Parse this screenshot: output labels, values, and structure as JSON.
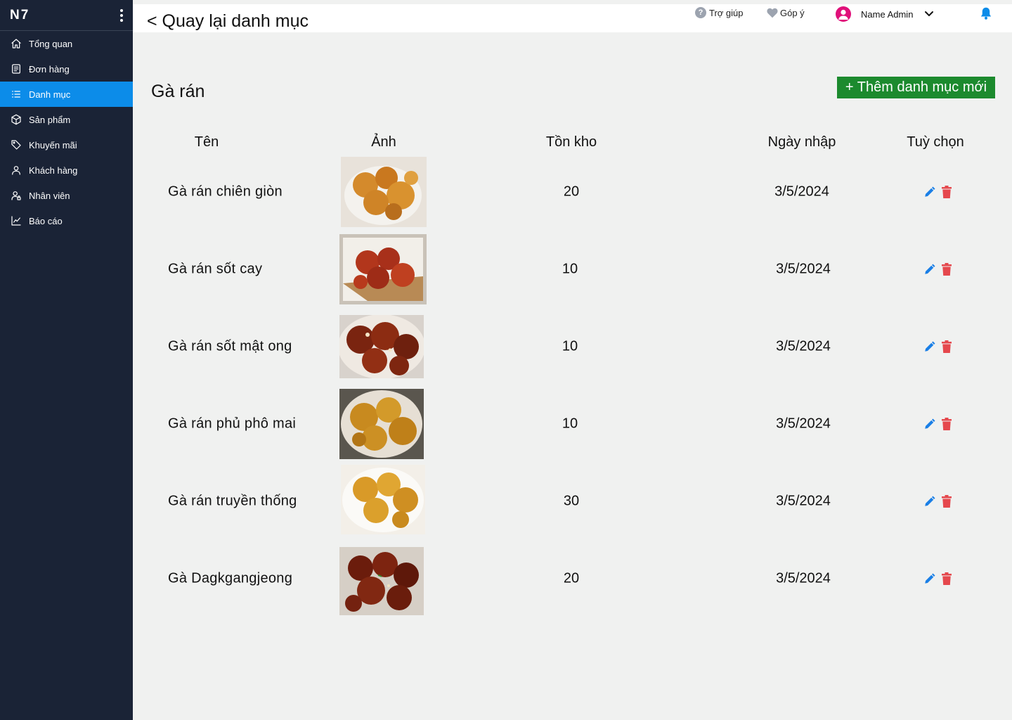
{
  "sidebar": {
    "brand": "N7",
    "items": [
      {
        "label": "Tổng quan",
        "icon": "home-icon"
      },
      {
        "label": "Đơn hàng",
        "icon": "document-icon"
      },
      {
        "label": "Danh mục",
        "icon": "list-icon",
        "active": true
      },
      {
        "label": "Sản phẩm",
        "icon": "box-icon"
      },
      {
        "label": "Khuyến mãi",
        "icon": "tag-icon"
      },
      {
        "label": "Khách hàng",
        "icon": "user-icon"
      },
      {
        "label": "Nhân viên",
        "icon": "staff-icon"
      },
      {
        "label": "Báo cáo",
        "icon": "chart-icon"
      }
    ]
  },
  "header": {
    "back_label": "< Quay lại danh mục",
    "help_label": "Trợ giúp",
    "feedback_label": "Góp ý",
    "user_name": "Name Admin"
  },
  "category": {
    "title": "Gà rán",
    "add_button": "+ Thêm danh mục mới"
  },
  "table": {
    "columns": [
      "Tên",
      "Ảnh",
      "Tồn kho",
      "Ngày nhập",
      "Tuỳ chọn"
    ],
    "rows": [
      {
        "name": "Gà rán chiên giòn",
        "stock": "20",
        "date": "3/5/2024"
      },
      {
        "name": "Gà rán sốt cay",
        "stock": "10",
        "date": "3/5/2024"
      },
      {
        "name": "Gà rán sốt mật ong",
        "stock": "10",
        "date": "3/5/2024"
      },
      {
        "name": "Gà rán phủ phô mai",
        "stock": "10",
        "date": "3/5/2024"
      },
      {
        "name": "Gà rán truyền thống",
        "stock": "30",
        "date": "3/5/2024"
      },
      {
        "name": "Gà Dagkgangjeong",
        "stock": "20",
        "date": "3/5/2024"
      }
    ]
  },
  "colors": {
    "sidebar_bg": "#1a2336",
    "active_item": "#0c8ce9",
    "add_button_bg": "#1c8a2e",
    "edit_icon": "#1a7fe6",
    "delete_icon": "#e5484d",
    "avatar": "#e0107a"
  }
}
